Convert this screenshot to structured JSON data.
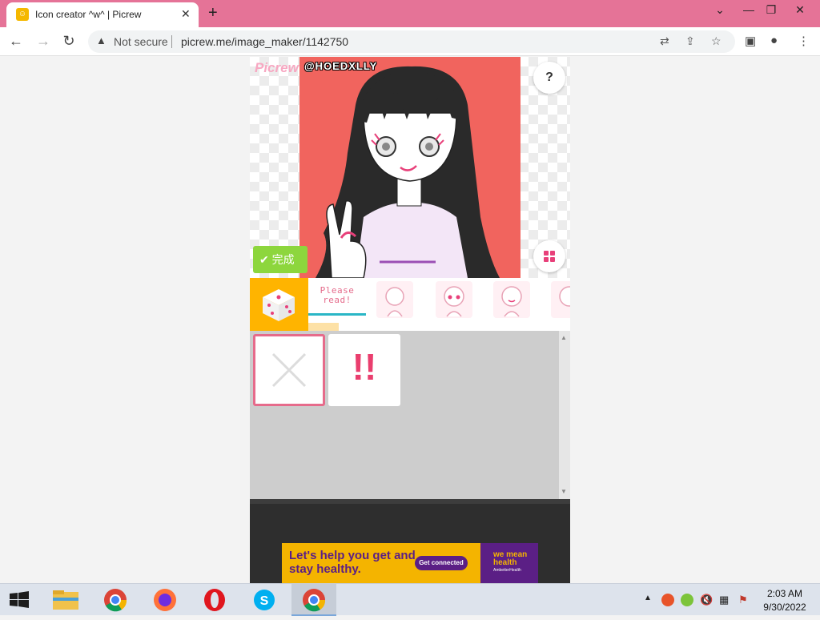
{
  "browser": {
    "tab_title": "Icon creator ^w^ | Picrew",
    "tab_close": "✕",
    "new_tab": "+",
    "security_label": "Not secure",
    "url": "picrew.me/image_maker/1142750",
    "window_controls": [
      "⌄",
      "—",
      "❐",
      "✕"
    ]
  },
  "maker": {
    "logo": "Picrew",
    "watermark": "@HOEDXLLY",
    "help_label": "?",
    "done_label": "完成",
    "please_read": "Please read!",
    "background_color": "#f1645e",
    "accent_color": "#8dd63d"
  },
  "categories": [
    {
      "name": "please-read",
      "active": true
    },
    {
      "name": "face-base"
    },
    {
      "name": "face-eyes"
    },
    {
      "name": "face-mouth"
    },
    {
      "name": "face-ears"
    }
  ],
  "items": [
    {
      "name": "none",
      "selected": true
    },
    {
      "name": "exclamation",
      "symbol": "!!"
    }
  ],
  "ad": {
    "headline": "Let's help you get and stay healthy.",
    "cta": "Get connected",
    "brand": "we mean health",
    "brand_sub": "AmbetterHealth"
  },
  "taskbar": {
    "apps": [
      "file-explorer",
      "chrome",
      "firefox",
      "opera",
      "skype",
      "chrome-active"
    ],
    "time": "2:03 AM",
    "date": "9/30/2022"
  }
}
